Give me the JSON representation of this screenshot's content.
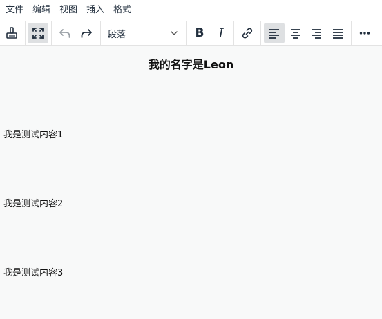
{
  "menubar": {
    "items": [
      "文件",
      "编辑",
      "视图",
      "插入",
      "格式"
    ]
  },
  "toolbar": {
    "block_format": "段落",
    "bold_glyph": "B",
    "italic_glyph": "I",
    "buttons": [
      {
        "icon": "format-painter-icon",
        "active": false
      },
      {
        "icon": "fullscreen-icon",
        "active": true
      },
      {
        "icon": "undo-icon",
        "active": false,
        "disabled": true
      },
      {
        "icon": "redo-icon",
        "active": false
      },
      {
        "icon": "bold-icon",
        "active": false
      },
      {
        "icon": "italic-icon",
        "active": false
      },
      {
        "icon": "link-icon",
        "active": false
      },
      {
        "icon": "align-left-icon",
        "active": true
      },
      {
        "icon": "align-center-icon",
        "active": false
      },
      {
        "icon": "align-right-icon",
        "active": false
      },
      {
        "icon": "align-justify-icon",
        "active": false
      },
      {
        "icon": "more-icon",
        "active": false
      }
    ]
  },
  "document": {
    "title": "我的名字是Leon",
    "paragraphs": [
      "我是测试内容1",
      "我是测试内容2",
      "我是测试内容3"
    ]
  },
  "colors": {
    "toolbar_bg": "#ffffff",
    "content_bg": "#f8f9f9",
    "active_button_bg": "#dee0e2",
    "icon": "#222f3e",
    "disabled_icon": "#9aa0a6"
  }
}
